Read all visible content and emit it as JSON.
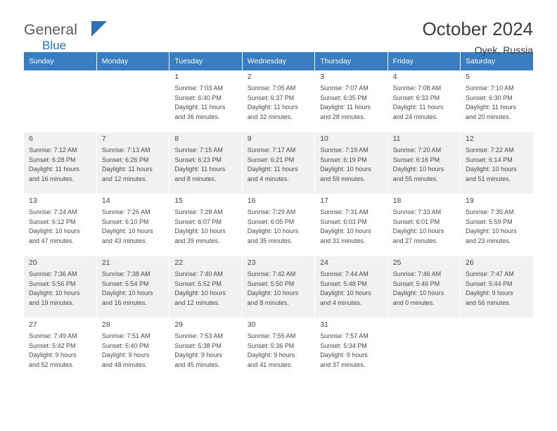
{
  "brand": {
    "name_top": "General",
    "name_bottom": "Blue",
    "accent_color": "#2a72b5"
  },
  "header": {
    "title": "October 2024",
    "subtitle": "Oyek, Russia"
  },
  "calendar": {
    "header_bg": "#3a7dc0",
    "weekdays": [
      "Sunday",
      "Monday",
      "Tuesday",
      "Wednesday",
      "Thursday",
      "Friday",
      "Saturday"
    ],
    "weeks": [
      [
        {
          "day": "",
          "detail": ""
        },
        {
          "day": "",
          "detail": ""
        },
        {
          "day": "1",
          "detail": "Sunrise: 7:03 AM\nSunset: 6:40 PM\nDaylight: 11 hours\nand 36 minutes."
        },
        {
          "day": "2",
          "detail": "Sunrise: 7:05 AM\nSunset: 6:37 PM\nDaylight: 11 hours\nand 32 minutes."
        },
        {
          "day": "3",
          "detail": "Sunrise: 7:07 AM\nSunset: 6:35 PM\nDaylight: 11 hours\nand 28 minutes."
        },
        {
          "day": "4",
          "detail": "Sunrise: 7:08 AM\nSunset: 6:33 PM\nDaylight: 11 hours\nand 24 minutes."
        },
        {
          "day": "5",
          "detail": "Sunrise: 7:10 AM\nSunset: 6:30 PM\nDaylight: 11 hours\nand 20 minutes."
        }
      ],
      [
        {
          "day": "6",
          "detail": "Sunrise: 7:12 AM\nSunset: 6:28 PM\nDaylight: 11 hours\nand 16 minutes."
        },
        {
          "day": "7",
          "detail": "Sunrise: 7:13 AM\nSunset: 6:26 PM\nDaylight: 11 hours\nand 12 minutes."
        },
        {
          "day": "8",
          "detail": "Sunrise: 7:15 AM\nSunset: 6:23 PM\nDaylight: 11 hours\nand 8 minutes."
        },
        {
          "day": "9",
          "detail": "Sunrise: 7:17 AM\nSunset: 6:21 PM\nDaylight: 11 hours\nand 4 minutes."
        },
        {
          "day": "10",
          "detail": "Sunrise: 7:19 AM\nSunset: 6:19 PM\nDaylight: 10 hours\nand 59 minutes."
        },
        {
          "day": "11",
          "detail": "Sunrise: 7:20 AM\nSunset: 6:16 PM\nDaylight: 10 hours\nand 55 minutes."
        },
        {
          "day": "12",
          "detail": "Sunrise: 7:22 AM\nSunset: 6:14 PM\nDaylight: 10 hours\nand 51 minutes."
        }
      ],
      [
        {
          "day": "13",
          "detail": "Sunrise: 7:24 AM\nSunset: 6:12 PM\nDaylight: 10 hours\nand 47 minutes."
        },
        {
          "day": "14",
          "detail": "Sunrise: 7:26 AM\nSunset: 6:10 PM\nDaylight: 10 hours\nand 43 minutes."
        },
        {
          "day": "15",
          "detail": "Sunrise: 7:28 AM\nSunset: 6:07 PM\nDaylight: 10 hours\nand 39 minutes."
        },
        {
          "day": "16",
          "detail": "Sunrise: 7:29 AM\nSunset: 6:05 PM\nDaylight: 10 hours\nand 35 minutes."
        },
        {
          "day": "17",
          "detail": "Sunrise: 7:31 AM\nSunset: 6:03 PM\nDaylight: 10 hours\nand 31 minutes."
        },
        {
          "day": "18",
          "detail": "Sunrise: 7:33 AM\nSunset: 6:01 PM\nDaylight: 10 hours\nand 27 minutes."
        },
        {
          "day": "19",
          "detail": "Sunrise: 7:35 AM\nSunset: 5:59 PM\nDaylight: 10 hours\nand 23 minutes."
        }
      ],
      [
        {
          "day": "20",
          "detail": "Sunrise: 7:36 AM\nSunset: 5:56 PM\nDaylight: 10 hours\nand 19 minutes."
        },
        {
          "day": "21",
          "detail": "Sunrise: 7:38 AM\nSunset: 5:54 PM\nDaylight: 10 hours\nand 16 minutes."
        },
        {
          "day": "22",
          "detail": "Sunrise: 7:40 AM\nSunset: 5:52 PM\nDaylight: 10 hours\nand 12 minutes."
        },
        {
          "day": "23",
          "detail": "Sunrise: 7:42 AM\nSunset: 5:50 PM\nDaylight: 10 hours\nand 8 minutes."
        },
        {
          "day": "24",
          "detail": "Sunrise: 7:44 AM\nSunset: 5:48 PM\nDaylight: 10 hours\nand 4 minutes."
        },
        {
          "day": "25",
          "detail": "Sunrise: 7:46 AM\nSunset: 5:46 PM\nDaylight: 10 hours\nand 0 minutes."
        },
        {
          "day": "26",
          "detail": "Sunrise: 7:47 AM\nSunset: 5:44 PM\nDaylight: 9 hours\nand 56 minutes."
        }
      ],
      [
        {
          "day": "27",
          "detail": "Sunrise: 7:49 AM\nSunset: 5:42 PM\nDaylight: 9 hours\nand 52 minutes."
        },
        {
          "day": "28",
          "detail": "Sunrise: 7:51 AM\nSunset: 5:40 PM\nDaylight: 9 hours\nand 48 minutes."
        },
        {
          "day": "29",
          "detail": "Sunrise: 7:53 AM\nSunset: 5:38 PM\nDaylight: 9 hours\nand 45 minutes."
        },
        {
          "day": "30",
          "detail": "Sunrise: 7:55 AM\nSunset: 5:36 PM\nDaylight: 9 hours\nand 41 minutes."
        },
        {
          "day": "31",
          "detail": "Sunrise: 7:57 AM\nSunset: 5:34 PM\nDaylight: 9 hours\nand 37 minutes."
        },
        {
          "day": "",
          "detail": ""
        },
        {
          "day": "",
          "detail": ""
        }
      ]
    ]
  }
}
